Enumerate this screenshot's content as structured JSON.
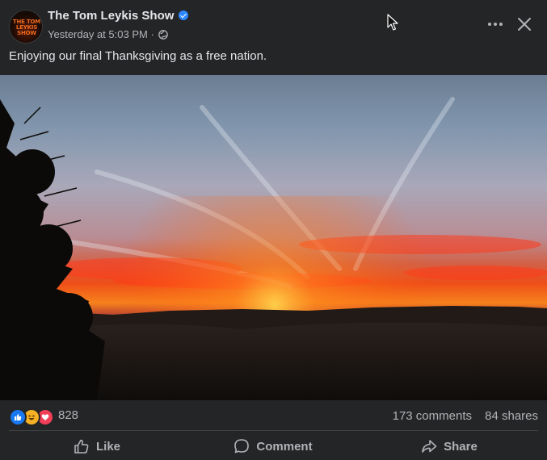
{
  "post": {
    "page_name": "The Tom Leykis Show",
    "verified": true,
    "timestamp": "Yesterday at 5:03 PM",
    "separator": "·",
    "audience_icon": "globe-icon",
    "caption": "Enjoying our final Thanksgiving as a free nation.",
    "avatar_text": "THE TOM LEYKIS SHOW"
  },
  "header_actions": {
    "more_icon": "more-horizontal-icon",
    "close_icon": "close-icon"
  },
  "stats": {
    "reaction_icons": [
      "like-reaction-icon",
      "haha-reaction-icon",
      "love-reaction-icon"
    ],
    "reaction_count": "828",
    "comments": "173 comments",
    "shares": "84 shares"
  },
  "actions": {
    "like": "Like",
    "comment": "Comment",
    "share": "Share"
  },
  "colors": {
    "background": "#242526",
    "text": "#e4e6eb",
    "secondary_text": "#b0b3b8",
    "verified": "#2d88ff",
    "like": "#1877f2",
    "love": "#f33e58",
    "haha": "#f7b125"
  }
}
